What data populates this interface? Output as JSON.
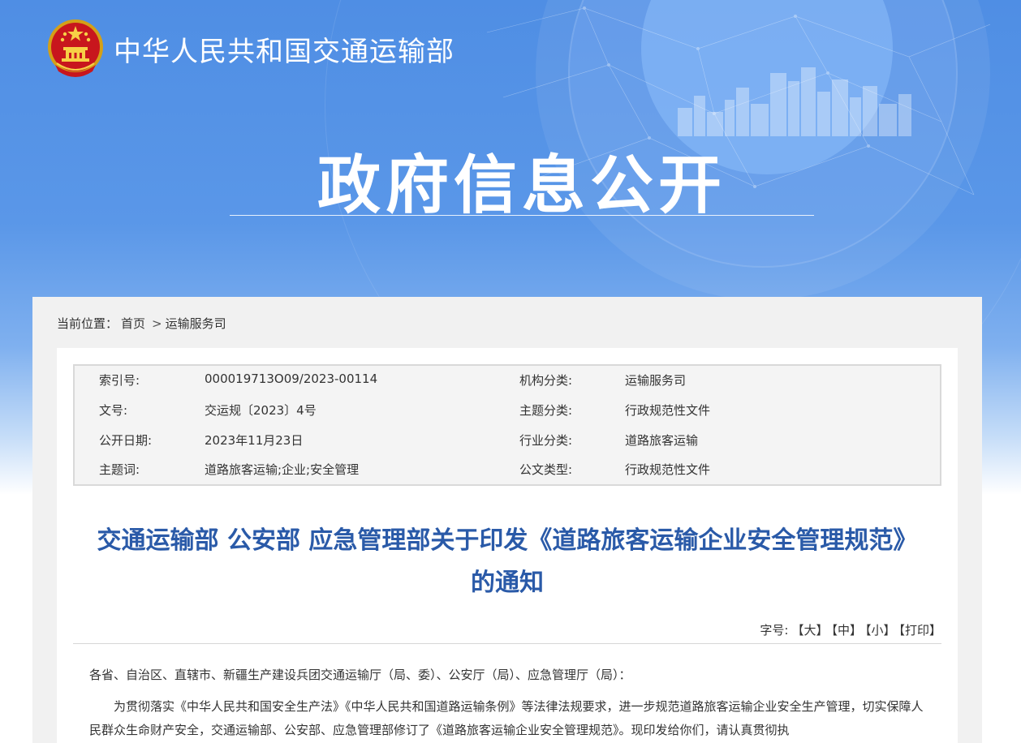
{
  "header": {
    "ministry_name": "中华人民共和国交通运输部",
    "banner_title": "政府信息公开"
  },
  "breadcrumb": {
    "label": "当前位置：",
    "items": [
      "首页",
      "运输服务司"
    ],
    "separator": ">"
  },
  "metadata": {
    "rows": [
      {
        "k1": "索引号:",
        "v1": "000019713O09/2023-00114",
        "k2": "机构分类:",
        "v2": "运输服务司"
      },
      {
        "k1": "文号:",
        "v1": "交运规〔2023〕4号",
        "k2": "主题分类:",
        "v2": "行政规范性文件"
      },
      {
        "k1": "公开日期:",
        "v1": "2023年11月23日",
        "k2": "行业分类:",
        "v2": "道路旅客运输"
      },
      {
        "k1": "主题词:",
        "v1": "道路旅客运输;企业;安全管理",
        "k2": "公文类型:",
        "v2": "行政规范性文件"
      }
    ]
  },
  "document": {
    "title": "交通运输部 公安部 应急管理部关于印发《道路旅客运输企业安全管理规范》的通知",
    "font_size_label": "字号:",
    "font_size_options": [
      "【大】",
      "【中】",
      "【小】",
      "【打印】"
    ],
    "salutation": "各省、自治区、直辖市、新疆生产建设兵团交通运输厅（局、委）、公安厅（局）、应急管理厅（局）：",
    "paragraph": "为贯彻落实《中华人民共和国安全生产法》《中华人民共和国道路运输条例》等法律法规要求，进一步规范道路旅客运输企业安全生产管理，切实保障人民群众生命财产安全，交通运输部、公安部、应急管理部修订了《道路旅客运输企业安全管理规范》。现印发给你们，请认真贯彻执"
  },
  "colors": {
    "banner_blue": "#4f8ee4",
    "title_blue": "#2a5aa8"
  }
}
